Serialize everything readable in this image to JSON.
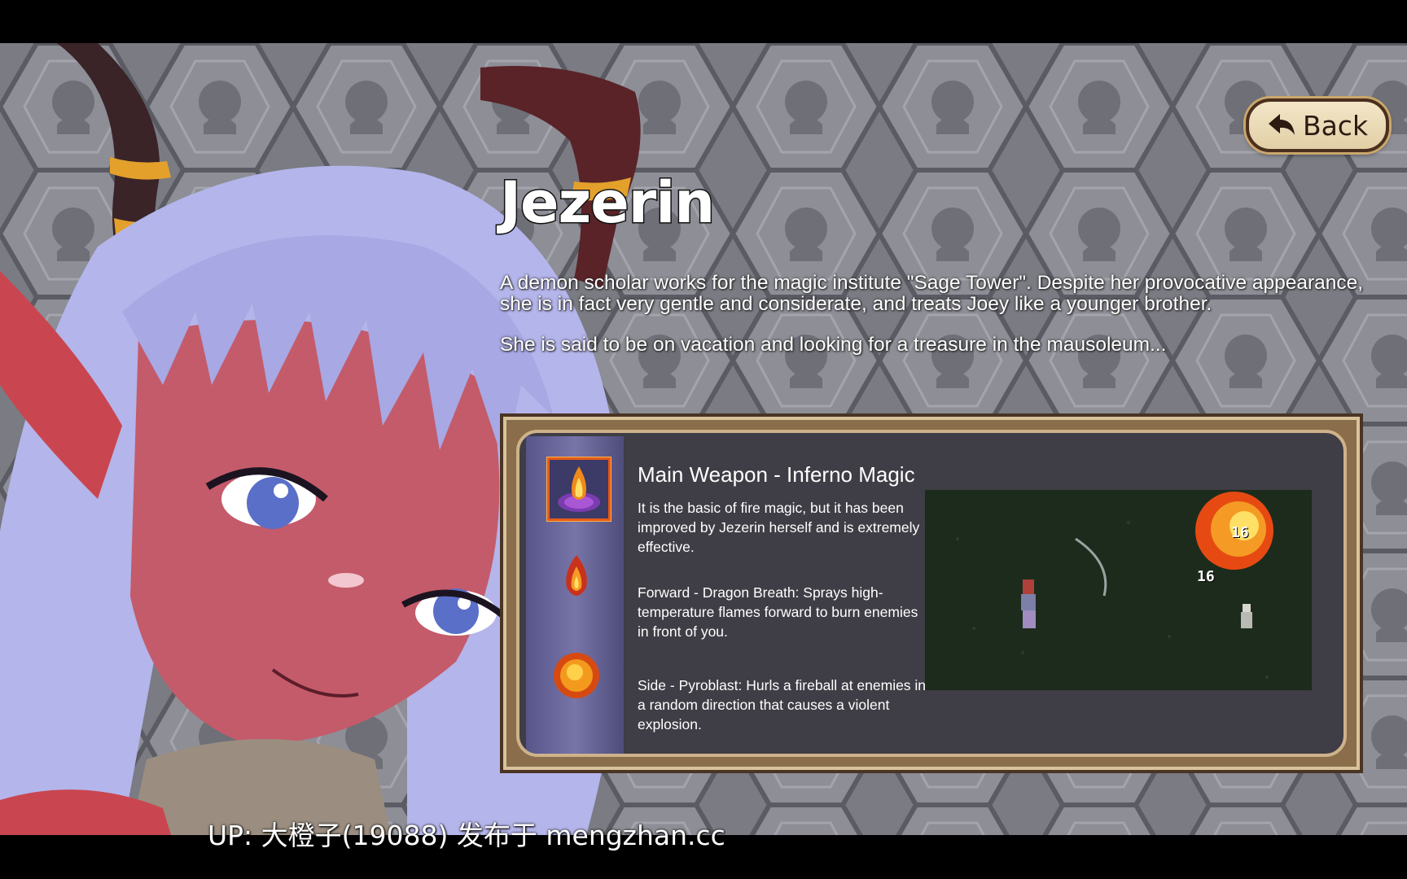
{
  "window": {
    "back_label": "Back"
  },
  "character": {
    "name": "Jezerin",
    "description": [
      "A demon scholar works for the magic institute \"Sage Tower\". Despite her provocative appearance, she is in fact very gentle and considerate, and treats Joey like a younger brother.",
      "She is said to be on vacation and looking for a treasure in the mausoleum..."
    ]
  },
  "weapon": {
    "title": "Main Weapon - Inferno Magic",
    "paragraphs": [
      "It is the basic of fire magic, but it has been improved by Jezerin herself and is extremely effective.",
      "Forward - Dragon Breath: Sprays high-temperature flames forward to burn enemies in front of you.",
      "Side - Pyroblast: Hurls a fireball at enemies in a random direction that causes a violent explosion."
    ],
    "skills": [
      {
        "icon": "fire-pillar-icon",
        "selected": true
      },
      {
        "icon": "dragon-breath-icon",
        "selected": false
      },
      {
        "icon": "fireball-icon",
        "selected": false
      }
    ],
    "preview": {
      "damage_numbers": [
        "16",
        "16"
      ]
    }
  },
  "watermark": "UP: 大橙子(19088) 发布于 mengzhan.cc",
  "colors": {
    "panel_frame": "#8a6d4b",
    "panel_bg": "#3f3d45",
    "button_bg": "#efe0c0",
    "accent_fire": "#e65a18"
  }
}
